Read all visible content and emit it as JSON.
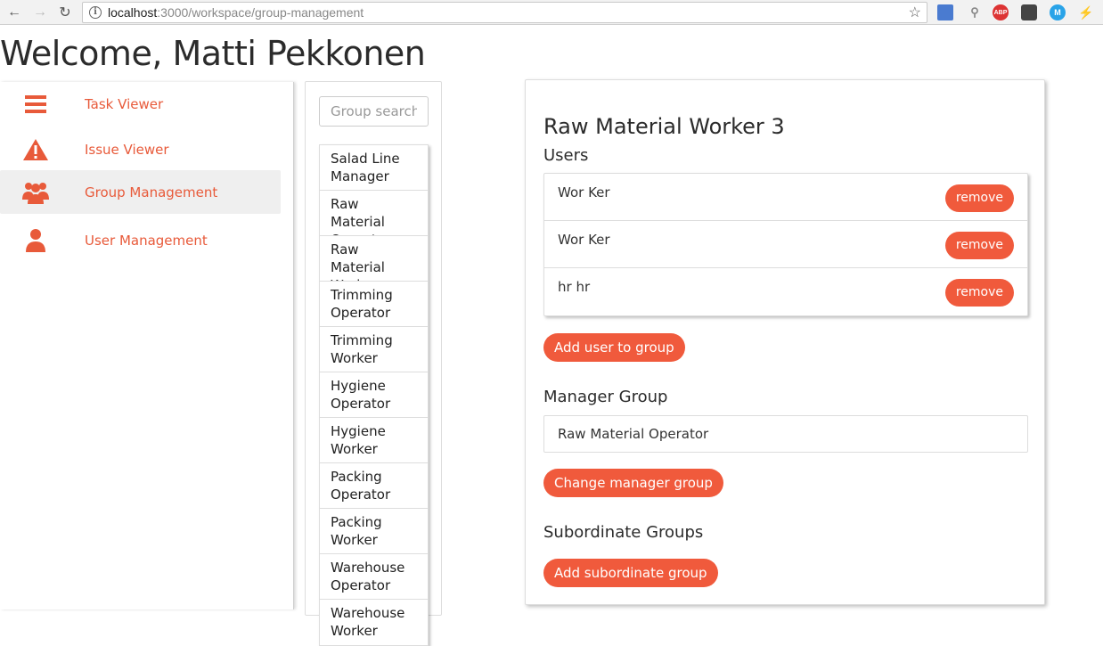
{
  "browser": {
    "url_host": "localhost",
    "url_path": ":3000/workspace/group-management",
    "extensions": [
      "ABP",
      "M"
    ]
  },
  "welcome_text": "Welcome, Matti Pekkonen",
  "sidebar": {
    "items": [
      {
        "label": "Task Viewer",
        "icon": "menu-lines-icon",
        "active": false
      },
      {
        "label": "Issue Viewer",
        "icon": "warning-icon",
        "active": false
      },
      {
        "label": "Group Management",
        "icon": "group-icon",
        "active": true
      },
      {
        "label": "User Management",
        "icon": "user-icon",
        "active": false
      }
    ]
  },
  "group_search": {
    "placeholder": "Group search",
    "value": ""
  },
  "groups": [
    "Salad Line Manager",
    "Raw Material Operator",
    "Raw Material Worker",
    "Trimming Operator",
    "Trimming Worker",
    "Hygiene Operator",
    "Hygiene Worker",
    "Packing Operator",
    "Packing Worker",
    "Warehouse Operator",
    "Warehouse Worker"
  ],
  "detail": {
    "title": "Raw Material Worker 3",
    "users_heading": "Users",
    "users": [
      {
        "name": "Wor Ker",
        "action": "remove"
      },
      {
        "name": "Wor Ker",
        "action": "remove"
      },
      {
        "name": "hr hr",
        "action": "remove"
      }
    ],
    "add_user_label": "Add user to group",
    "manager_heading": "Manager Group",
    "manager_group": "Raw Material Operator",
    "change_manager_label": "Change manager group",
    "subordinate_heading": "Subordinate Groups",
    "add_subordinate_label": "Add subordinate group"
  },
  "colors": {
    "accent": "#f05a3c",
    "sidebar_text": "#e85a3a",
    "active_bg": "#efefef"
  }
}
